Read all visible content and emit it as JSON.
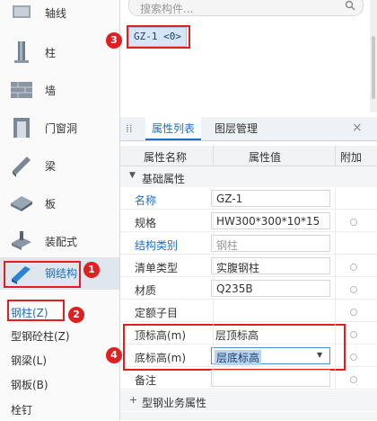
{
  "nav": {
    "items": [
      {
        "label": "轴线"
      },
      {
        "label": "柱"
      },
      {
        "label": "墙"
      },
      {
        "label": "门窗洞"
      },
      {
        "label": "梁"
      },
      {
        "label": "板"
      },
      {
        "label": "装配式"
      },
      {
        "label": "钢结构"
      }
    ],
    "sub_items": [
      {
        "label": "钢柱(Z)"
      },
      {
        "label": "型钢砼柱(Z)"
      },
      {
        "label": "钢梁(L)"
      },
      {
        "label": "钢板(B)"
      },
      {
        "label": "栓钉"
      }
    ]
  },
  "badges": {
    "b1": "1",
    "b2": "2",
    "b3": "3",
    "b4": "4"
  },
  "search": {
    "placeholder": "搜索构件..."
  },
  "component_list": {
    "selected": "GZ-1 <0>"
  },
  "tabs": {
    "properties": "属性列表",
    "layers": "图层管理"
  },
  "grid": {
    "headers": {
      "name": "属性名称",
      "value": "属性值",
      "extra": "附加"
    },
    "section_basic": "基础属性",
    "section_steel": "型钢业务属性",
    "rows": [
      {
        "name": "名称",
        "value": "GZ-1"
      },
      {
        "name": "规格",
        "value": "HW300*300*10*15"
      },
      {
        "name": "结构类别",
        "value": "钢柱"
      },
      {
        "name": "清单类型",
        "value": "实腹钢柱"
      },
      {
        "name": "材质",
        "value": "Q235B"
      },
      {
        "name": "定额子目",
        "value": ""
      },
      {
        "name": "顶标高(m)",
        "value": "层顶标高"
      },
      {
        "name": "底标高(m)",
        "value": "层底标高"
      },
      {
        "name": "备注",
        "value": ""
      }
    ]
  }
}
